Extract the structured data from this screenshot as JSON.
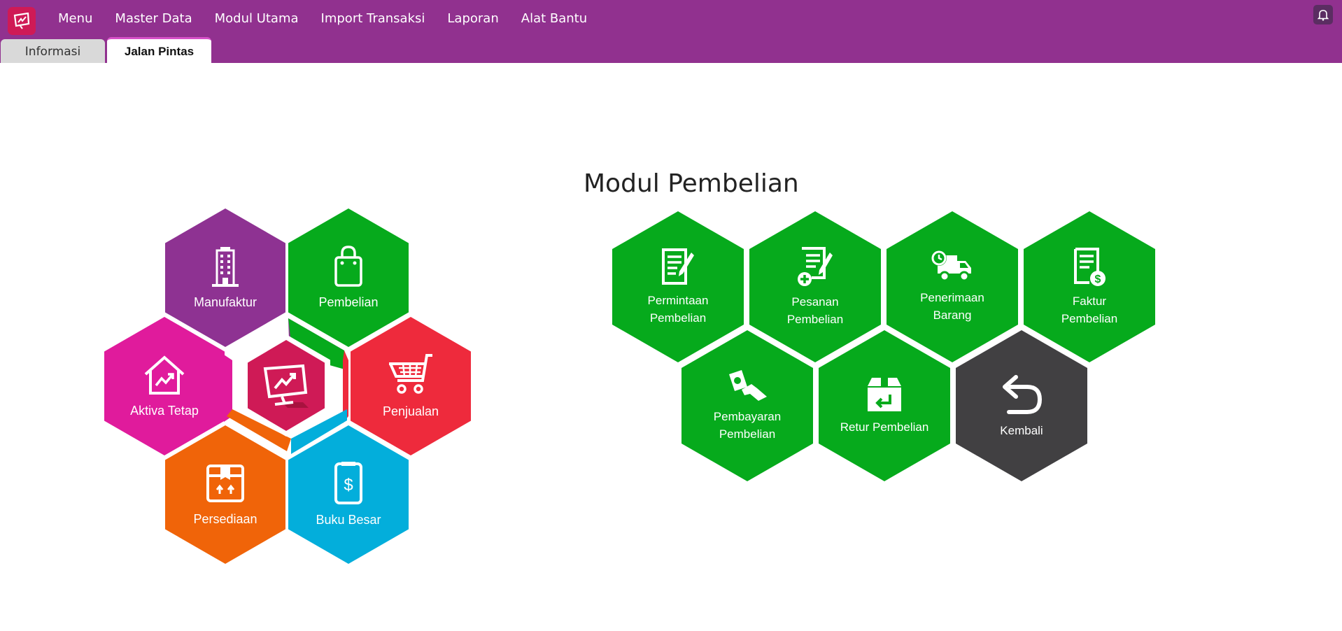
{
  "menubar": {
    "items": [
      "Menu",
      "Master Data",
      "Modul Utama",
      "Import Transaksi",
      "Laporan",
      "Alat Bantu"
    ]
  },
  "tabs": {
    "informasi": "Informasi",
    "jalan_pintas": "Jalan Pintas",
    "active": "Jalan Pintas"
  },
  "modules": {
    "manufaktur": "Manufaktur",
    "pembelian": "Pembelian",
    "aktiva_tetap": "Aktiva Tetap",
    "penjualan": "Penjualan",
    "persediaan": "Persediaan",
    "buku_besar": "Buku Besar"
  },
  "purchase_module": {
    "title": "Modul Pembelian",
    "permintaan": "Permintaan\nPembelian",
    "pesanan": "Pesanan\nPembelian",
    "penerimaan": "Penerimaan\nBarang",
    "faktur": "Faktur\nPembelian",
    "pembayaran": "Pembayaran\nPembelian",
    "retur": "Retur Pembelian",
    "kembali": "Kembali"
  },
  "colors": {
    "header": "#91318f",
    "manufaktur": "#8e3292",
    "pembelian": "#06aa1c",
    "aktiva_tetap": "#e01b9c",
    "penjualan": "#ee2a3c",
    "persediaan": "#f06409",
    "buku_besar": "#03aedb",
    "center": "#cf1a56",
    "kembali": "#414042"
  },
  "icons": {
    "app": "chart-monitor-icon",
    "notification": "bell-icon",
    "manufaktur": "building-icon",
    "pembelian": "shopping-bag-icon",
    "aktiva_tetap": "house-chart-icon",
    "penjualan": "shopping-cart-icon",
    "persediaan": "box-icon",
    "buku_besar": "ledger-dollar-icon",
    "permintaan": "document-pen-icon",
    "pesanan": "document-add-icon",
    "penerimaan": "delivery-truck-icon",
    "faktur": "invoice-dollar-icon",
    "pembayaran": "hand-money-icon",
    "retur": "return-box-icon",
    "kembali": "back-arrow-icon"
  }
}
